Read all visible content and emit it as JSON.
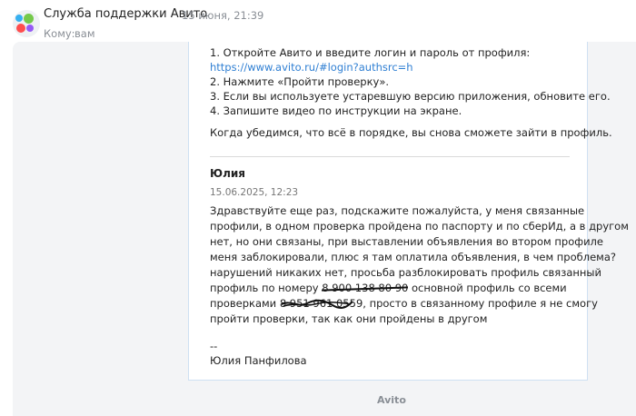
{
  "header": {
    "sender": "Служба поддержки Авито",
    "date": "15 июня, 21:39",
    "to_label": "Кому:",
    "to_value": "вам"
  },
  "quoted": {
    "lines": [
      "1. Откройте Авито и введите логин и пароль от профиля:",
      "https://www.avito.ru/#login?authsrc=h",
      "2. Нажмите «Пройти проверку».",
      "3. Если вы используете устаревшую версию приложения, обновите его.",
      "4. Запишите видео по инструкции на экране."
    ],
    "closing": "Когда убедимся, что всё в порядке, вы снова сможете зайти в профиль."
  },
  "reply": {
    "author": "Юлия",
    "datetime": "15.06.2025, 12:23",
    "body_lines": [
      "Здравствуйте еще раз, подскажите пожалуйста, у меня связанные",
      "профили, в одном проверка пройдена по паспорту и по сберИд, а в другом",
      "нет, но они связаны, при выставлении объявления во втором профиле",
      "меня заблокировали, плюс я там оплатила объявления, в чем проблема?",
      "нарушений никаких нет, просьба разблокировать профиль связанный"
    ],
    "line6_before": "профиль по номеру",
    "line6_redacted": "8 900 138 80 90",
    "line6_after": "основной профиль со всеми",
    "line7_before": "проверками",
    "line7_redacted": "8 951 961 0559",
    "line7_after": ", просто в связанному профиле я не смогу",
    "line8": "пройти проверки, так как они пройдены в другом",
    "sig_sep": "--",
    "signature": "Юлия Панфилова"
  },
  "footer": {
    "brand": "Avito"
  },
  "colors": {
    "link": "#2f7fd3",
    "panel": "#f3f4f6",
    "card_border": "#cfe0f2"
  }
}
